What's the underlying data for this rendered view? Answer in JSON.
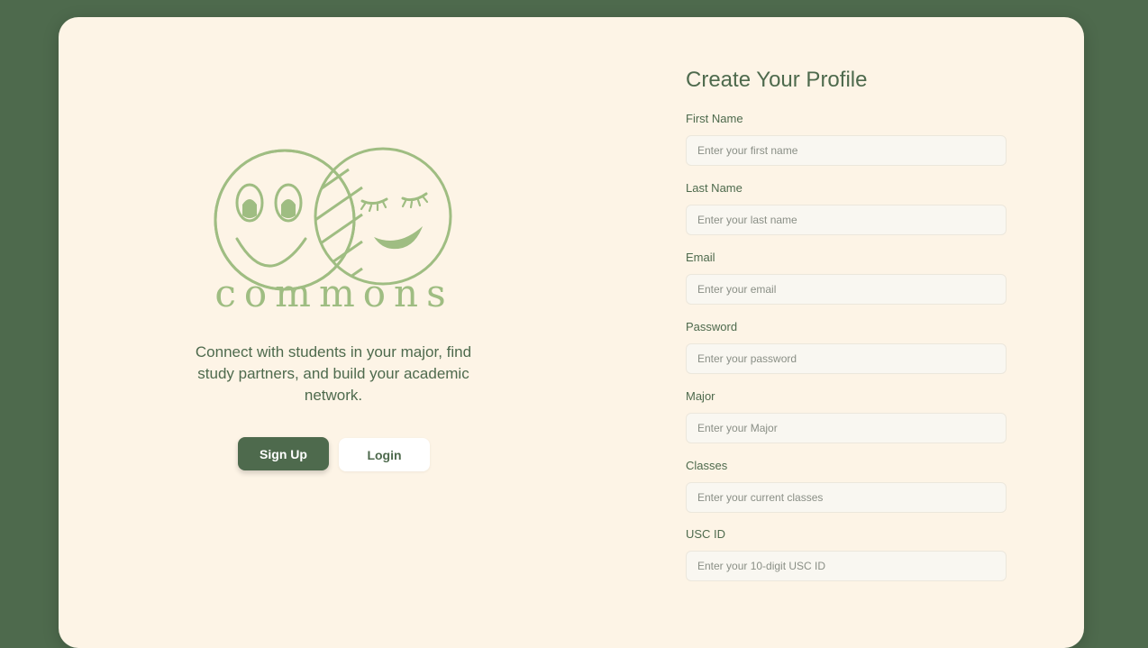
{
  "brand": {
    "name": "commons",
    "tagline": "Connect with students in your major, find study partners, and build your academic network."
  },
  "actions": {
    "signup_label": "Sign Up",
    "login_label": "Login"
  },
  "form": {
    "title": "Create Your Profile",
    "fields": [
      {
        "label": "First Name",
        "placeholder": "Enter your first name",
        "value": ""
      },
      {
        "label": "Last Name",
        "placeholder": "Enter your last name",
        "value": ""
      },
      {
        "label": "Email",
        "placeholder": "Enter your email",
        "value": ""
      },
      {
        "label": "Password",
        "placeholder": "Enter your password",
        "value": ""
      },
      {
        "label": "Major",
        "placeholder": "Enter your Major",
        "value": ""
      },
      {
        "label": "Classes",
        "placeholder": "Enter your current classes",
        "value": ""
      },
      {
        "label": "USC ID",
        "placeholder": "Enter your 10-digit USC ID",
        "value": ""
      }
    ]
  },
  "colors": {
    "background": "#4e6a4d",
    "card": "#fdf4e6",
    "accent": "#9fbd82",
    "primary_button": "#4e6a4d"
  },
  "icons": {
    "logo": "two-smiley-faces-logo"
  }
}
